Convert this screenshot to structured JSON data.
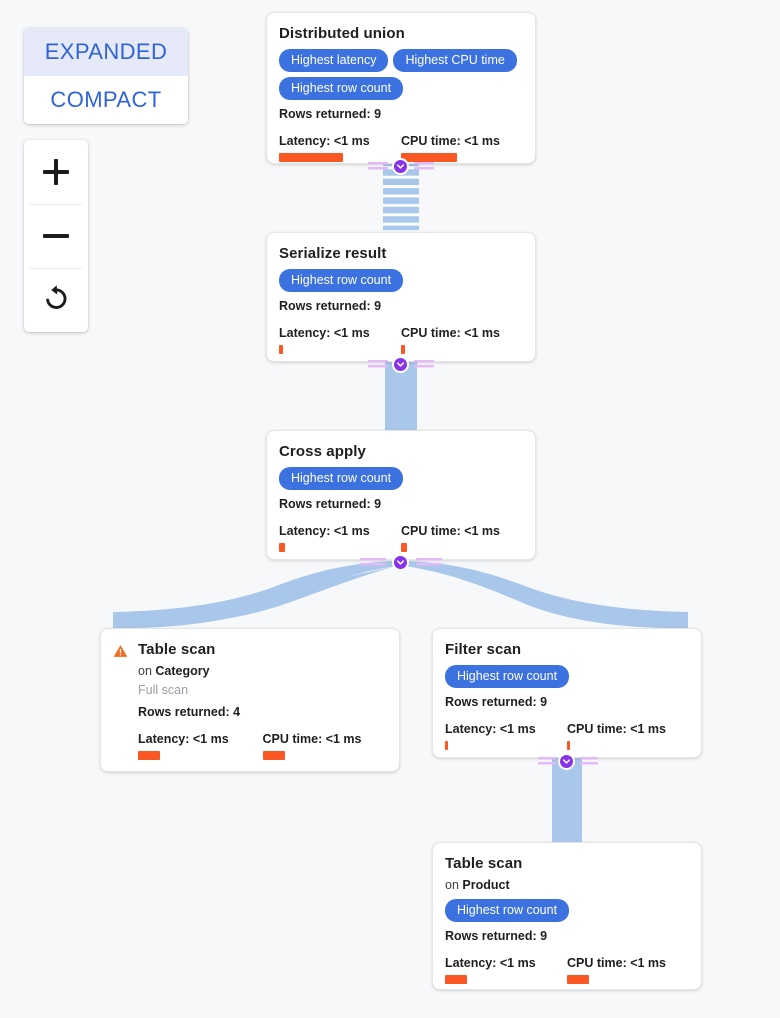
{
  "view_toggle": {
    "options": [
      {
        "label": "EXPANDED",
        "selected": true
      },
      {
        "label": "COMPACT",
        "selected": false
      }
    ]
  },
  "zoom_controls": {
    "zoom_in_label": "+",
    "zoom_out_label": "−",
    "reset_label": "reset-zoom-icon"
  },
  "colors": {
    "accent_chip": "#3b72e0",
    "metric_bar": "#fb5723",
    "edge": "#a8c7ea",
    "edge_badge": "#8833e8",
    "warning": "#ef7024",
    "toggle_text": "#2f63db",
    "toggle_selected_bg": "#e6eaf8",
    "canvas_bg": "#f7f8fa"
  },
  "labels": {
    "rows_prefix": "Rows returned: ",
    "latency_prefix": "Latency: ",
    "cpu_prefix": "CPU time: ",
    "on_prefix": "on "
  },
  "nodes": [
    {
      "id": "distributed-union",
      "title": "Distributed union",
      "chips": [
        "Highest latency",
        "Highest CPU time",
        "Highest row count"
      ],
      "rows_returned": "Rows returned: 9",
      "latency": "Latency: <1 ms",
      "cpu_time": "CPU time: <1 ms",
      "latency_bar_width": 64,
      "cpu_bar_width": 56,
      "warning": false
    },
    {
      "id": "serialize-result",
      "title": "Serialize result",
      "chips": [
        "Highest row count"
      ],
      "rows_returned": "Rows returned: 9",
      "latency": "Latency: <1 ms",
      "cpu_time": "CPU time: <1 ms",
      "latency_bar_width": 4,
      "cpu_bar_width": 4,
      "warning": false
    },
    {
      "id": "cross-apply",
      "title": "Cross apply",
      "chips": [
        "Highest row count"
      ],
      "rows_returned": "Rows returned: 9",
      "latency": "Latency: <1 ms",
      "cpu_time": "CPU time: <1 ms",
      "latency_bar_width": 6,
      "cpu_bar_width": 6,
      "warning": false
    },
    {
      "id": "table-scan-category",
      "title": "Table scan",
      "target": "on Category",
      "target_name": "Category",
      "note": "Full scan",
      "chips": [],
      "rows_returned": "Rows returned: 4",
      "latency": "Latency: <1 ms",
      "cpu_time": "CPU time: <1 ms",
      "latency_bar_width": 22,
      "cpu_bar_width": 22,
      "warning": true,
      "warning_name": "warning-icon"
    },
    {
      "id": "filter-scan",
      "title": "Filter scan",
      "chips": [
        "Highest row count"
      ],
      "rows_returned": "Rows returned: 9",
      "latency": "Latency: <1 ms",
      "cpu_time": "CPU time: <1 ms",
      "latency_bar_width": 3,
      "cpu_bar_width": 3,
      "warning": false
    },
    {
      "id": "table-scan-product",
      "title": "Table scan",
      "target": "on Product",
      "target_name": "Product",
      "note": "",
      "chips": [
        "Highest row count"
      ],
      "rows_returned": "Rows returned: 9",
      "latency": "Latency: <1 ms",
      "cpu_time": "CPU time: <1 ms",
      "latency_bar_width": 22,
      "cpu_bar_width": 22,
      "warning": false
    }
  ],
  "edges": [
    {
      "id": "edge-distributed-union-to-serialize-result",
      "style": "striped"
    },
    {
      "id": "edge-serialize-result-to-cross-apply",
      "style": "solid"
    },
    {
      "id": "edge-cross-apply-to-table-scan-category",
      "style": "curve"
    },
    {
      "id": "edge-cross-apply-to-filter-scan",
      "style": "curve"
    },
    {
      "id": "edge-filter-scan-to-table-scan-product",
      "style": "solid"
    }
  ]
}
